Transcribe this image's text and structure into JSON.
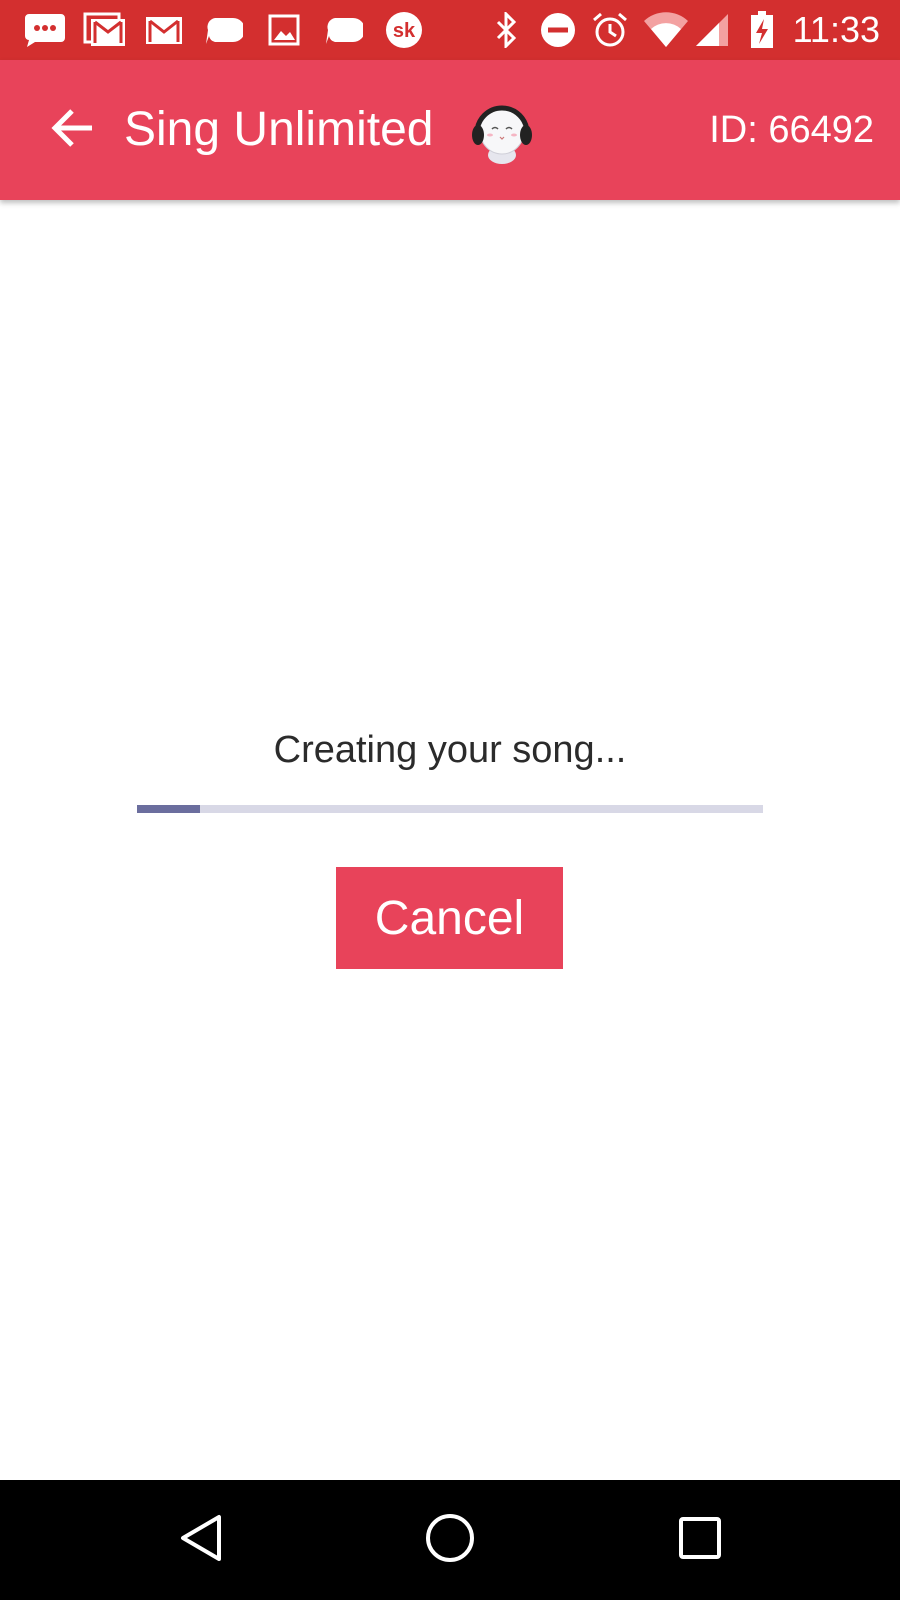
{
  "status_bar": {
    "time": "11:33",
    "left_icons": [
      "chat-bubble-dots-icon",
      "gmail-multi-icon",
      "gmail-icon",
      "message-bubble-icon",
      "image-icon",
      "message-bubble-icon",
      "sk-app-icon"
    ],
    "right_icons": [
      "bluetooth-icon",
      "do-not-disturb-icon",
      "alarm-icon",
      "wifi-icon",
      "cell-signal-icon",
      "battery-charging-icon"
    ],
    "background": "#d32f2f"
  },
  "app_bar": {
    "title": "Sing Unlimited",
    "id_label": "ID: 66492",
    "background": "#e8435a"
  },
  "main": {
    "status_text": "Creating your song...",
    "progress": 0.1,
    "progress_fill_color": "#6b6e9e",
    "progress_track_color": "#d8d8e6",
    "cancel_label": "Cancel"
  },
  "nav_bar": {
    "buttons": [
      "back-triangle-icon",
      "home-circle-icon",
      "recents-square-icon"
    ]
  }
}
